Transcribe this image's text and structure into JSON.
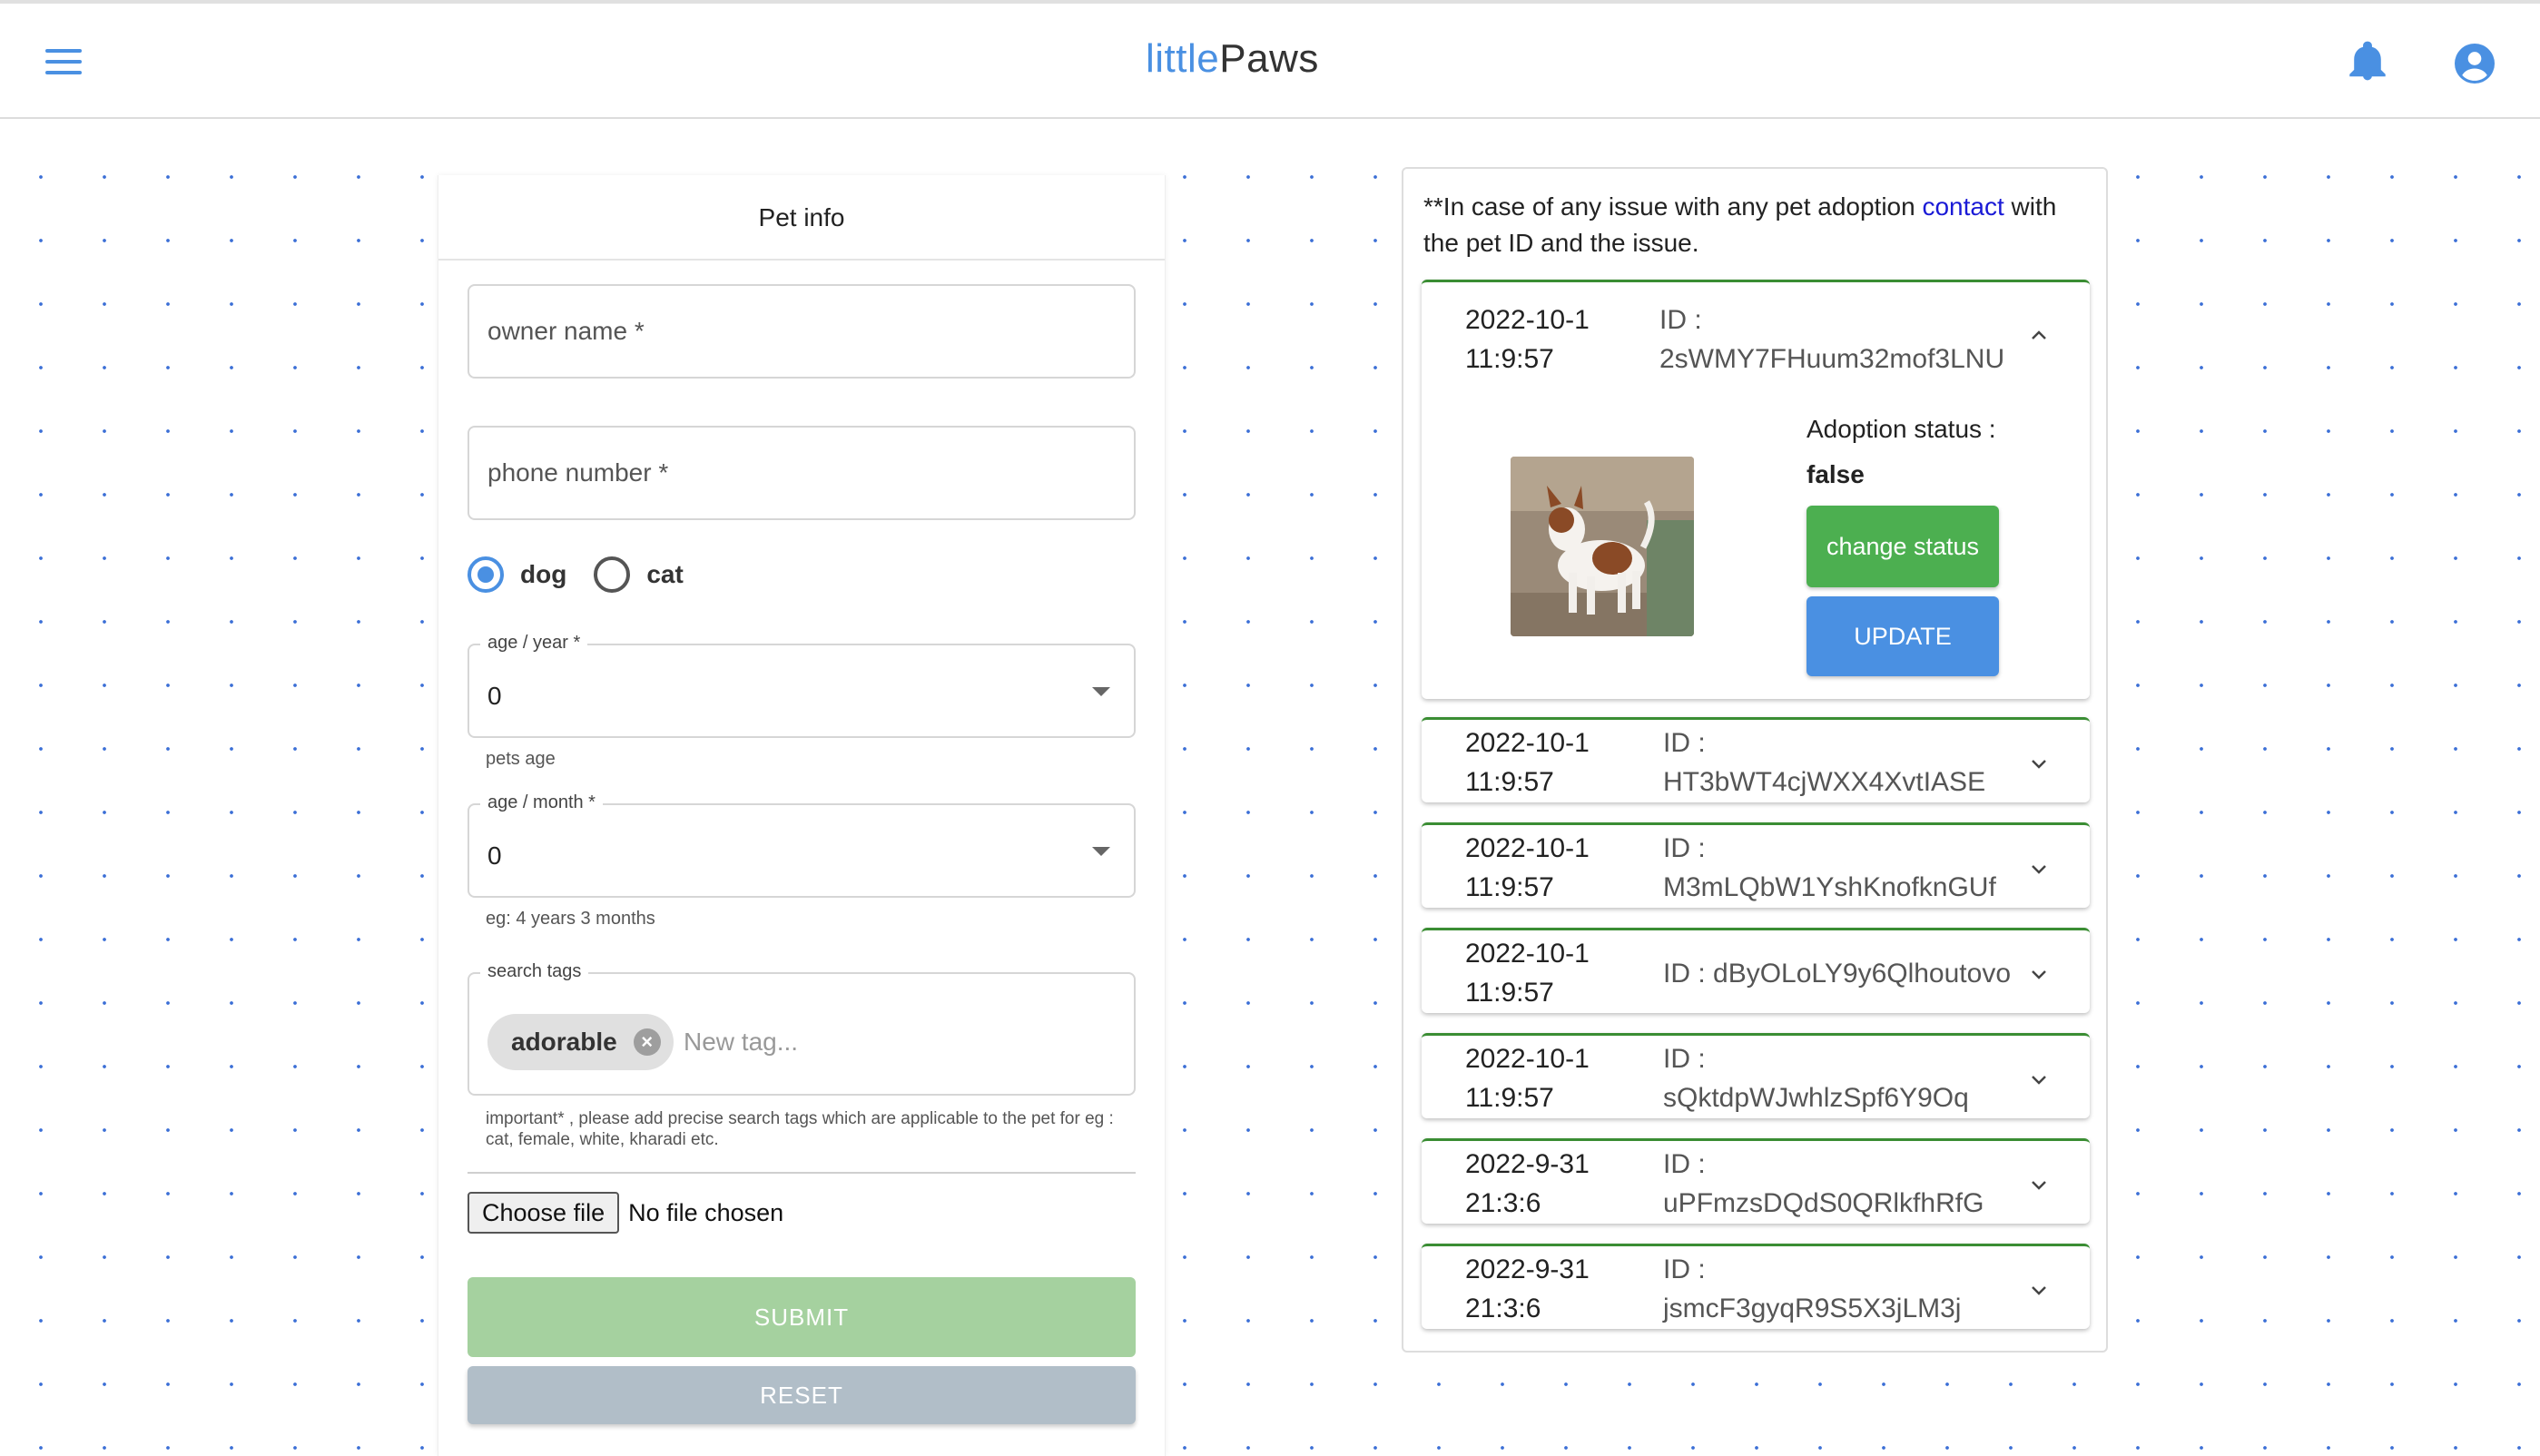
{
  "header": {
    "logo_part1": "little",
    "logo_part2": "Paws",
    "accent_color": "#4a90e2",
    "icons": [
      "menu-icon",
      "bell-icon",
      "account-circle-icon"
    ]
  },
  "form": {
    "title": "Pet info",
    "owner_placeholder": "owner name *",
    "phone_placeholder": "phone number *",
    "pet_types": [
      {
        "label": "dog",
        "checked": true
      },
      {
        "label": "cat",
        "checked": false
      }
    ],
    "age_year": {
      "label": "age / year *",
      "value": "0",
      "helper": "pets age"
    },
    "age_month": {
      "label": "age / month *",
      "value": "0",
      "helper": "eg: 4 years 3 months"
    },
    "tags": {
      "label": "search tags",
      "chips": [
        "adorable"
      ],
      "placeholder": "New tag...",
      "note": "important* , please add precise search tags which are applicable to the pet for eg : cat, female, white, kharadi etc."
    },
    "file": {
      "button": "Choose file",
      "status": "No file chosen"
    },
    "submit_label": "SUBMIT",
    "reset_label": "RESET"
  },
  "adoptions": {
    "notice_before": "**In case of any issue with any pet adoption ",
    "notice_link": "contact",
    "notice_after": " with the pet ID and the issue.",
    "id_prefix": "ID : ",
    "expanded": {
      "adoption_status_label": "Adoption status :",
      "adoption_status_value": "false",
      "change_status_label": "change status",
      "update_label": "UPDATE"
    },
    "items": [
      {
        "date": "2022-10-1",
        "time": "11:9:57",
        "id": "2sWMY7FHuum32mof3LNU",
        "expanded": true
      },
      {
        "date": "2022-10-1",
        "time": "11:9:57",
        "id": "HT3bWT4cjWXX4XvtIASE",
        "expanded": false
      },
      {
        "date": "2022-10-1",
        "time": "11:9:57",
        "id": "M3mLQbW1YshKnofknGUf",
        "expanded": false
      },
      {
        "date": "2022-10-1",
        "time": "11:9:57",
        "id": "dByOLoLY9y6Qlhoutovo",
        "expanded": false
      },
      {
        "date": "2022-10-1",
        "time": "11:9:57",
        "id": "sQktdpWJwhlzSpf6Y9Oq",
        "expanded": false
      },
      {
        "date": "2022-9-31",
        "time": "21:3:6",
        "id": "uPFmzsDQdS0QRlkfhRfG",
        "expanded": false
      },
      {
        "date": "2022-9-31",
        "time": "21:3:6",
        "id": "jsmcF3gyqR9S5X3jLM3j",
        "expanded": false
      }
    ]
  }
}
